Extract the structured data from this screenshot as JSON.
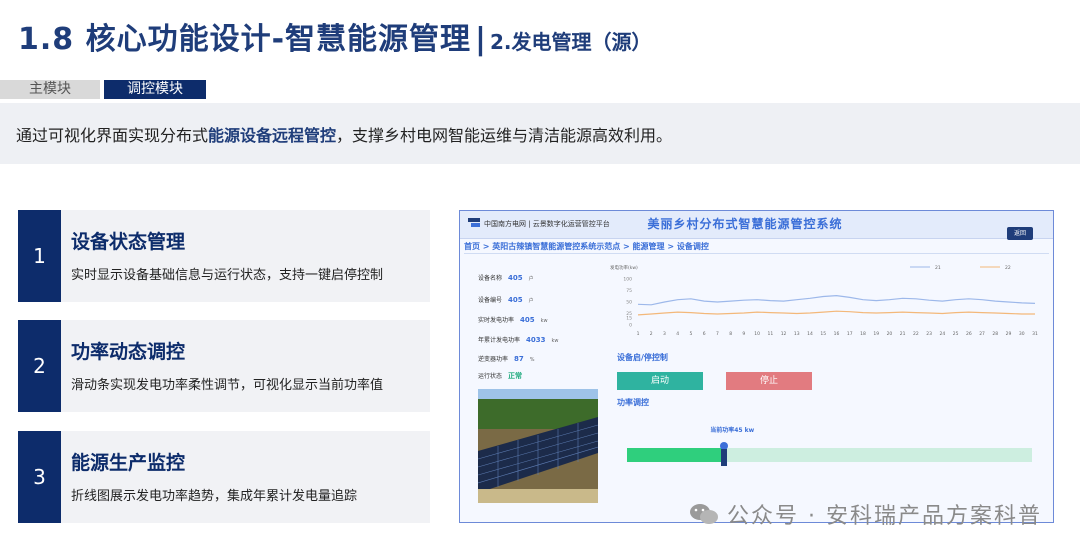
{
  "title": {
    "main": "1.8 核心功能设计-智慧能源管理",
    "separator": "|",
    "sub": "2.发电管理（源）"
  },
  "tabs": [
    {
      "label": "主模块"
    },
    {
      "label": "调控模块"
    }
  ],
  "banner": {
    "before": "通过可视化界面实现分布式",
    "highlight": "能源设备远程管控",
    "after": "，支撑乡村电网智能运维与清洁能源高效利用。"
  },
  "features": [
    {
      "num": "1",
      "title": "设备状态管理",
      "desc": "实时显示设备基础信息与运行状态，支持一键启停控制"
    },
    {
      "num": "2",
      "title": "功率动态调控",
      "desc": "滑动条实现发电功率柔性调节，可视化显示当前功率值"
    },
    {
      "num": "3",
      "title": "能源生产监控",
      "desc": "折线图展示发电功率趋势，集成年累计发电量追踪"
    }
  ],
  "app": {
    "org": "中国南方电网  |  云景数字化运营管控平台",
    "system_title": "美丽乡村分布式智慧能源管控系统",
    "back_label": "返回",
    "breadcrumb": "首页 > 英阳古辣镇智慧能源管控系统示范点 > 能源管理 > 设备调控",
    "info": [
      {
        "label": "设备名称",
        "value": "405",
        "unit": "户"
      },
      {
        "label": "设备编号",
        "value": "405",
        "unit": "户"
      },
      {
        "label": "实时发电功率",
        "value": "405",
        "unit": "kw"
      },
      {
        "label": "年累计发电功率",
        "value": "4033",
        "unit": "kw"
      },
      {
        "label": "逆变器功率",
        "value": "87",
        "unit": "%"
      },
      {
        "label": "运行状态",
        "value": "正常",
        "unit": ""
      }
    ],
    "control_title": "设备启/停控制",
    "start_label": "启动",
    "stop_label": "停止",
    "power_title": "功率调控",
    "power_label": "当前功率",
    "power_value": "45",
    "power_unit": "kw",
    "power_fraction": 0.24
  },
  "chart_data": {
    "type": "line",
    "ylabel": "发电功率(kw)",
    "ylim": [
      0,
      100
    ],
    "yticks": [
      0,
      15,
      25,
      50,
      75,
      100
    ],
    "x": [
      1,
      2,
      3,
      4,
      5,
      6,
      7,
      8,
      9,
      10,
      11,
      12,
      13,
      14,
      15,
      16,
      17,
      18,
      19,
      20,
      21,
      22,
      23,
      24,
      25,
      26,
      27,
      28,
      29,
      30,
      31
    ],
    "series": [
      {
        "name": "21",
        "color": "#9db8ea",
        "values": [
          45,
          44,
          50,
          55,
          57,
          52,
          50,
          52,
          54,
          55,
          53,
          52,
          55,
          58,
          62,
          64,
          60,
          55,
          53,
          55,
          58,
          57,
          54,
          52,
          55,
          57,
          55,
          52,
          50,
          48,
          47
        ]
      },
      {
        "name": "22",
        "color": "#f3b87a",
        "values": [
          22,
          24,
          26,
          28,
          27,
          25,
          24,
          25,
          26,
          28,
          27,
          26,
          25,
          26,
          28,
          30,
          29,
          27,
          26,
          27,
          28,
          27,
          26,
          25,
          27,
          28,
          27,
          26,
          25,
          24,
          24
        ]
      }
    ],
    "grid": false,
    "legend": "top-right"
  },
  "watermark": "公众号 · 安科瑞产品方案科普"
}
